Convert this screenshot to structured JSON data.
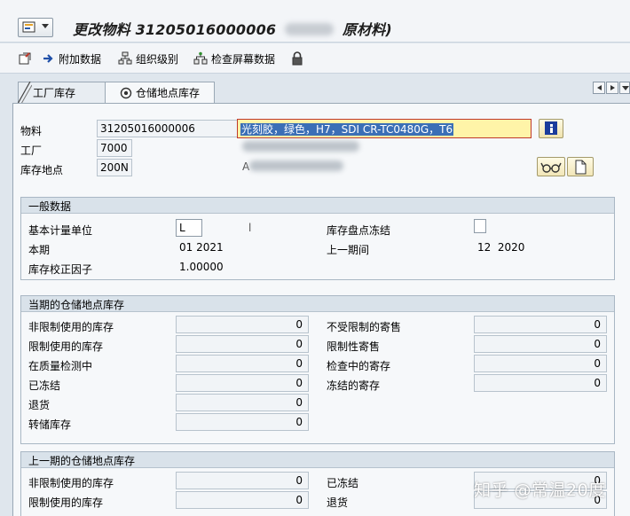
{
  "window": {
    "title_prefix": "更改物料",
    "material_number": "31205016000006",
    "title_suffix": "原材料)"
  },
  "toolbar": {
    "items": [
      {
        "label": "附加数据",
        "icon": "arrow-right-icon"
      },
      {
        "label": "组织级别",
        "icon": "org-levels-icon"
      },
      {
        "label": "检查屏幕数据",
        "icon": "check-data-icon"
      }
    ],
    "lock_icon": "lock-icon"
  },
  "tabs": [
    {
      "label": "工厂库存",
      "active": false
    },
    {
      "label": "仓储地点库存",
      "active": true
    }
  ],
  "header": {
    "material_label": "物料",
    "material_value": "31205016000006",
    "description_value": "光刻胶，绿色，H7，SDI CR-TC0480G，T6",
    "plant_label": "工厂",
    "plant_value": "7000",
    "storage_label": "库存地点",
    "storage_value": "200N",
    "storage_desc_visible": "A"
  },
  "general": {
    "title": "一般数据",
    "base_uom_label": "基本计量单位",
    "base_uom_value": "L",
    "base_uom_text": "l",
    "inventory_freeze_label": "库存盘点冻结",
    "current_period_label": "本期",
    "current_period_value": "01 2021",
    "prev_period_label": "上一期间",
    "prev_period_value": "12  2020",
    "correction_factor_label": "库存校正因子",
    "correction_factor_value": "1.00000"
  },
  "current_stock": {
    "title": "当期的仓储地点库存",
    "left": [
      {
        "label": "非限制使用的库存",
        "value": "0"
      },
      {
        "label": "限制使用的库存",
        "value": "0"
      },
      {
        "label": "在质量检测中",
        "value": "0"
      },
      {
        "label": "已冻结",
        "value": "0"
      },
      {
        "label": "退货",
        "value": "0"
      },
      {
        "label": "转储库存",
        "value": "0"
      }
    ],
    "right": [
      {
        "label": "不受限制的寄售",
        "value": "0"
      },
      {
        "label": "限制性寄售",
        "value": "0"
      },
      {
        "label": "检查中的寄存",
        "value": "0"
      },
      {
        "label": "冻结的寄存",
        "value": "0"
      }
    ]
  },
  "previous_stock": {
    "title": "上一期的仓储地点库存",
    "left": [
      {
        "label": "非限制使用的库存",
        "value": "0"
      },
      {
        "label": "限制使用的库存",
        "value": "0"
      }
    ],
    "right": [
      {
        "label": "已冻结",
        "value": "0"
      },
      {
        "label": "退货",
        "value": "0"
      }
    ]
  },
  "watermark": "知乎 @常温20度",
  "colors": {
    "highlight": "#fff4a8",
    "selection": "#3b6fb6",
    "panel_bg": "#f6f8fa",
    "group_header": "#d9e2ea"
  }
}
